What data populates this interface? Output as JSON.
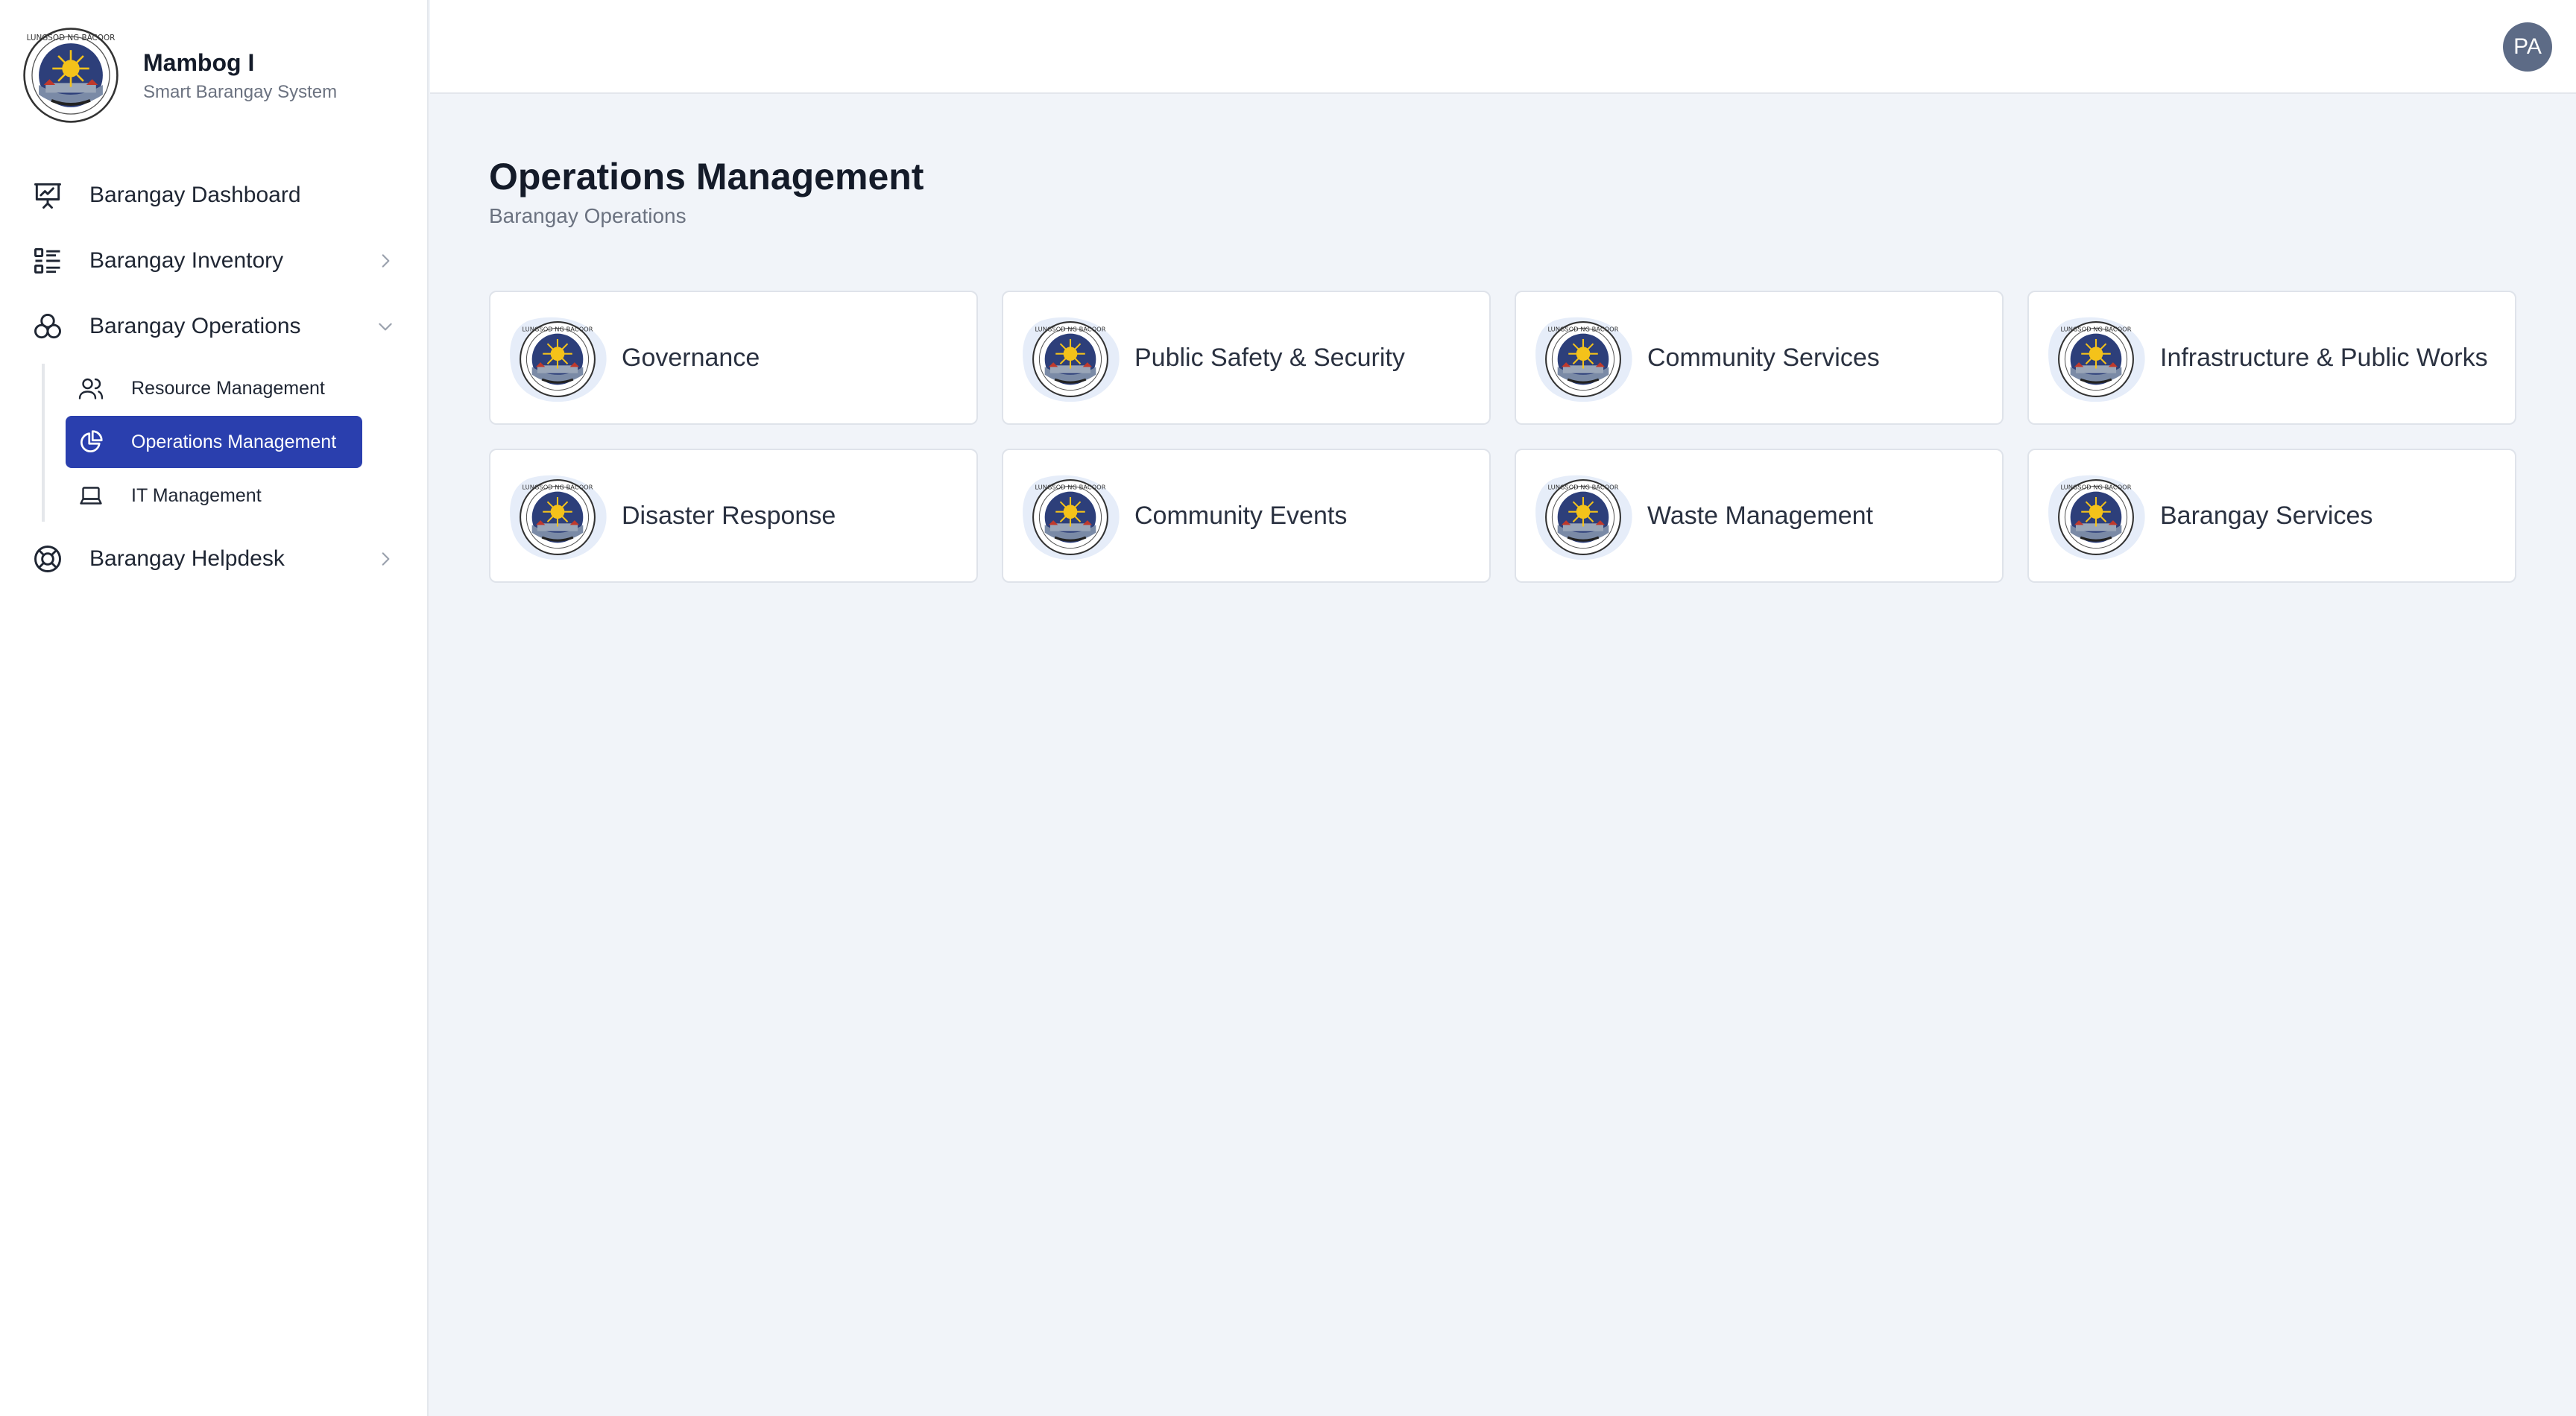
{
  "brand": {
    "name": "Mambog I",
    "subtitle": "Smart Barangay System",
    "logo_icon": "barangay-seal"
  },
  "sidebar": {
    "items": [
      {
        "label": "Barangay Dashboard",
        "icon": "presentation-chart-icon"
      },
      {
        "label": "Barangay Inventory",
        "icon": "list-icon",
        "expanded": false
      },
      {
        "label": "Barangay Operations",
        "icon": "cubes-icon",
        "expanded": true
      },
      {
        "label": "Barangay Helpdesk",
        "icon": "lifebuoy-icon",
        "expanded": false
      }
    ],
    "operations_children": [
      {
        "label": "Resource Management",
        "icon": "users-icon"
      },
      {
        "label": "Operations Management",
        "icon": "pie-chart-icon",
        "active": true
      },
      {
        "label": "IT Management",
        "icon": "laptop-icon"
      }
    ]
  },
  "header": {
    "avatar_initials": "PA"
  },
  "main": {
    "title": "Operations Management",
    "subtitle": "Barangay Operations",
    "cards": [
      {
        "label": "Governance"
      },
      {
        "label": "Public Safety & Security"
      },
      {
        "label": "Community Services"
      },
      {
        "label": "Infrastructure & Public Works"
      },
      {
        "label": "Disaster Response"
      },
      {
        "label": "Community Events"
      },
      {
        "label": "Waste Management"
      },
      {
        "label": "Barangay Services"
      }
    ]
  },
  "colors": {
    "accent": "#2a3fae",
    "background": "#f1f4f9",
    "avatar": "#5d6b86",
    "card_blob": "#e6edf9"
  }
}
